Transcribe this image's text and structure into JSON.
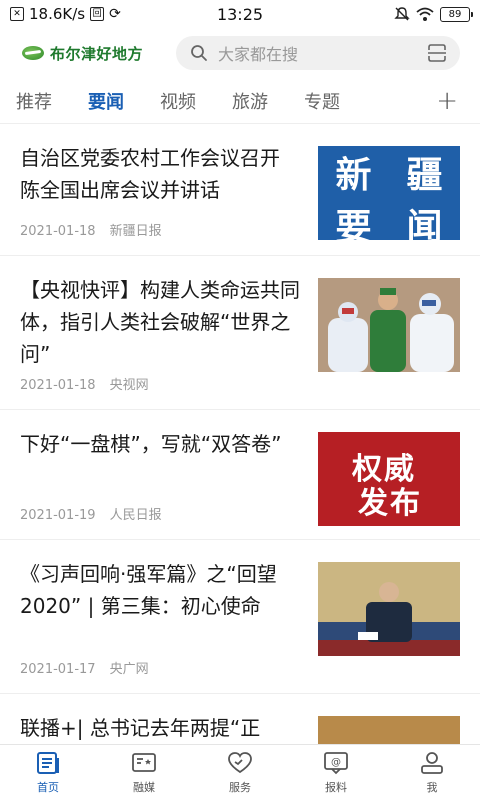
{
  "status_bar": {
    "speed": "18.6K/s",
    "time": "13:25",
    "battery": "89"
  },
  "header": {
    "logo_text": "布尔津好地方",
    "search_placeholder": "大家都在搜"
  },
  "tabs": [
    {
      "label": "推荐",
      "active": false
    },
    {
      "label": "要闻",
      "active": true
    },
    {
      "label": "视频",
      "active": false
    },
    {
      "label": "旅游",
      "active": false
    },
    {
      "label": "专题",
      "active": false
    }
  ],
  "tab_plus": "+",
  "thumb_texts": {
    "xinjiang": [
      "新",
      "疆",
      "要",
      "闻"
    ],
    "quanwei_top": "权威",
    "quanwei_bottom": "发布"
  },
  "news": [
    {
      "title": "自治区党委农村工作会议召开 陈全国出席会议并讲话",
      "date": "2021-01-18",
      "source": "新疆日报"
    },
    {
      "title": "【央视快评】构建人类命运共同体，指引人类社会破解“世界之问”",
      "date": "2021-01-18",
      "source": "央视网"
    },
    {
      "title": "下好“一盘棋”，写就“双答卷”",
      "date": "2021-01-19",
      "source": "人民日报"
    },
    {
      "title": "《习声回响·强军篇》之“回望2020” | 第三集：初心使命",
      "date": "2021-01-17",
      "source": "央广网"
    },
    {
      "title": "联播+| 总书记去年两提“正"
    }
  ],
  "bottom_nav": [
    {
      "label": "首页",
      "icon": "home-icon",
      "active": true
    },
    {
      "label": "融媒",
      "icon": "media-icon",
      "active": false
    },
    {
      "label": "服务",
      "icon": "service-icon",
      "active": false
    },
    {
      "label": "报料",
      "icon": "report-icon",
      "active": false
    },
    {
      "label": "我",
      "icon": "user-icon",
      "active": false
    }
  ],
  "colors": {
    "accent": "#1a5fb4",
    "logo_green": "#1f7a2e"
  }
}
